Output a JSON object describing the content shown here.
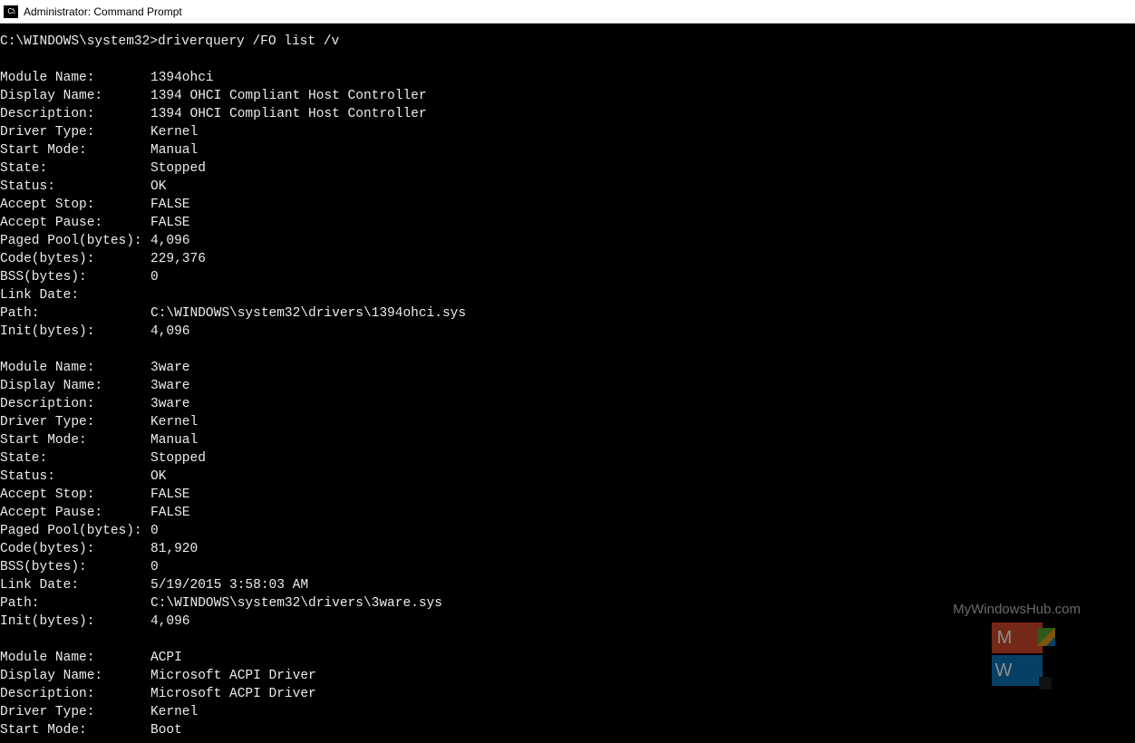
{
  "window": {
    "icon_label": "C:\\",
    "title": "Administrator: Command Prompt"
  },
  "prompt": {
    "path": "C:\\WINDOWS\\system32>",
    "command": "driverquery /FO list /v"
  },
  "field_labels": {
    "module_name": "Module Name:",
    "display_name": "Display Name:",
    "description": "Description:",
    "driver_type": "Driver Type:",
    "start_mode": "Start Mode:",
    "state": "State:",
    "status": "Status:",
    "accept_stop": "Accept Stop:",
    "accept_pause": "Accept Pause:",
    "paged_pool": "Paged Pool(bytes):",
    "code": "Code(bytes):",
    "bss": "BSS(bytes):",
    "link_date": "Link Date:",
    "path": "Path:",
    "init": "Init(bytes):"
  },
  "records": [
    {
      "module_name": "1394ohci",
      "display_name": "1394 OHCI Compliant Host Controller",
      "description": "1394 OHCI Compliant Host Controller",
      "driver_type": "Kernel",
      "start_mode": "Manual",
      "state": "Stopped",
      "status": "OK",
      "accept_stop": "FALSE",
      "accept_pause": "FALSE",
      "paged_pool": "4,096",
      "code": "229,376",
      "bss": "0",
      "link_date": "",
      "path": "C:\\WINDOWS\\system32\\drivers\\1394ohci.sys",
      "init": "4,096"
    },
    {
      "module_name": "3ware",
      "display_name": "3ware",
      "description": "3ware",
      "driver_type": "Kernel",
      "start_mode": "Manual",
      "state": "Stopped",
      "status": "OK",
      "accept_stop": "FALSE",
      "accept_pause": "FALSE",
      "paged_pool": "0",
      "code": "81,920",
      "bss": "0",
      "link_date": "5/19/2015 3:58:03 AM",
      "path": "C:\\WINDOWS\\system32\\drivers\\3ware.sys",
      "init": "4,096"
    },
    {
      "module_name": "ACPI",
      "display_name": "Microsoft ACPI Driver",
      "description": "Microsoft ACPI Driver",
      "driver_type": "Kernel",
      "start_mode": "Boot"
    }
  ],
  "watermark": {
    "text": "MyWindowsHub.com",
    "top_letter": "M",
    "bottom_letter": "W"
  }
}
